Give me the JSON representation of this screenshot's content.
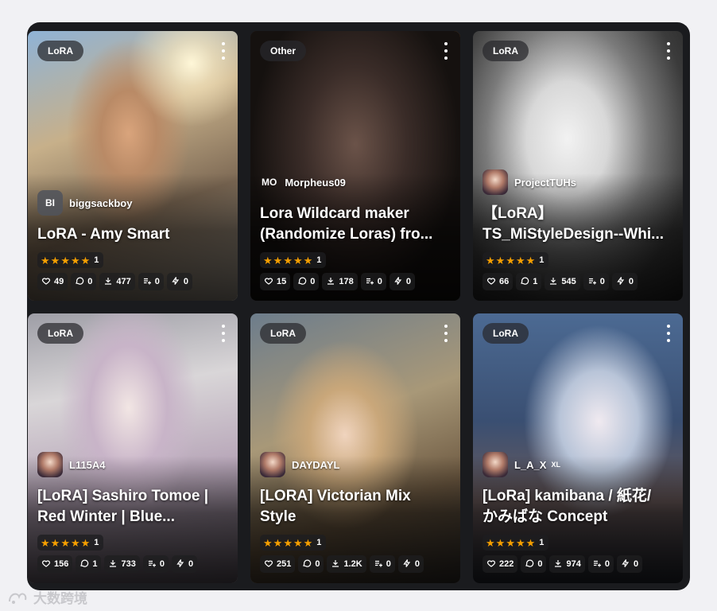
{
  "cards": [
    {
      "type": "LoRA",
      "creator": {
        "avatar_text": "BI",
        "name": "biggsackboy"
      },
      "title_lines": [
        "LoRA - Amy Smart"
      ],
      "rating_count": "1",
      "stats": {
        "likes": "49",
        "comments": "0",
        "downloads": "477",
        "collections": "0",
        "buzz": "0"
      }
    },
    {
      "type": "Other",
      "creator": {
        "avatar_text": "MO",
        "name": "Morpheus09"
      },
      "title_lines": [
        "Lora Wildcard maker",
        "(Randomize Loras) fro..."
      ],
      "rating_count": "1",
      "stats": {
        "likes": "15",
        "comments": "0",
        "downloads": "178",
        "collections": "0",
        "buzz": "0"
      }
    },
    {
      "type": "LoRA",
      "creator": {
        "avatar_text": "",
        "name": "ProjectTUHs"
      },
      "title_lines": [
        "【LoRA】",
        "TS_MiStyleDesign--Whi..."
      ],
      "rating_count": "1",
      "stats": {
        "likes": "66",
        "comments": "1",
        "downloads": "545",
        "collections": "0",
        "buzz": "0"
      }
    },
    {
      "type": "LoRA",
      "creator": {
        "avatar_text": "",
        "name": "L115A4"
      },
      "title_lines": [
        "[LoRA] Sashiro Tomoe |",
        "Red Winter | Blue..."
      ],
      "rating_count": "1",
      "stats": {
        "likes": "156",
        "comments": "1",
        "downloads": "733",
        "collections": "0",
        "buzz": "0"
      }
    },
    {
      "type": "LoRA",
      "creator": {
        "avatar_text": "",
        "name": "DAYDAYL"
      },
      "title_lines": [
        "[LORA] Victorian Mix",
        "Style"
      ],
      "rating_count": "1",
      "stats": {
        "likes": "251",
        "comments": "0",
        "downloads": "1.2K",
        "collections": "0",
        "buzz": "0"
      }
    },
    {
      "type": "LoRA",
      "creator": {
        "avatar_text": "",
        "name": "L_A_X",
        "badge": "XL"
      },
      "title_lines": [
        "[LoRa] kamibana / 紙花/",
        "かみばな Concept"
      ],
      "rating_count": "1",
      "stats": {
        "likes": "222",
        "comments": "0",
        "downloads": "974",
        "collections": "0",
        "buzz": "0"
      }
    }
  ],
  "watermark": "大数跨境",
  "colors": {
    "star": "#f59f00",
    "panel": "#1a1b1e"
  }
}
